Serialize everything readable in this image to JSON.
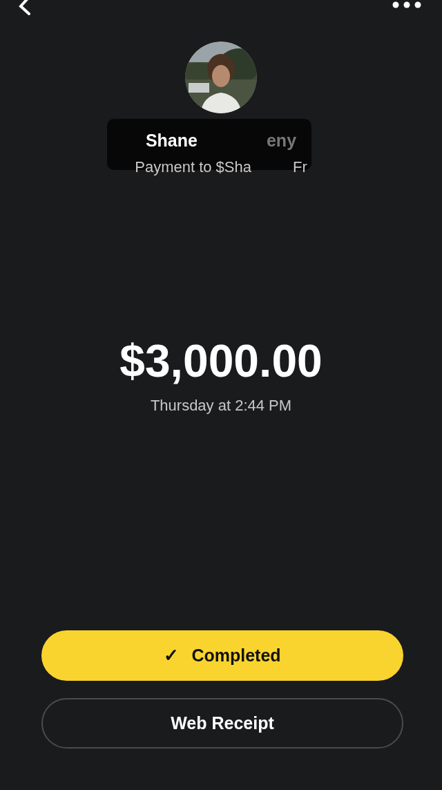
{
  "recipient": {
    "name_parts": [
      "Shane",
      "eny"
    ],
    "handle_parts": [
      "Payment to $Sha",
      "Fr"
    ]
  },
  "payment": {
    "amount": "$3,000.00",
    "time": "Thursday at 2:44 PM"
  },
  "actions": [
    {
      "kind": "status",
      "label": "Completed",
      "icon": "✓"
    },
    {
      "kind": "outline",
      "label": "Web Receipt"
    }
  ]
}
